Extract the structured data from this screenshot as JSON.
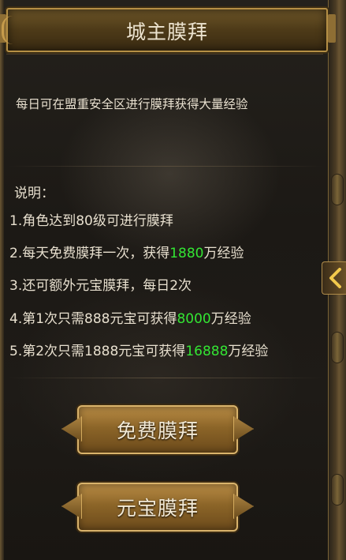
{
  "panel": {
    "title": "城主膜拜",
    "intro": "每日可在盟重安全区进行膜拜获得大量经验",
    "rules_heading": "说明：",
    "rules": [
      {
        "pre": "1.角色达到80级可进行膜拜",
        "hl": "",
        "post": ""
      },
      {
        "pre": "2.每天免费膜拜一次，获得",
        "hl": "1880",
        "post": "万经验"
      },
      {
        "pre": "3.还可额外元宝膜拜，每日2次",
        "hl": "",
        "post": ""
      },
      {
        "pre": "4.第1次只需888元宝可获得",
        "hl": "8000",
        "post": "万经验"
      },
      {
        "pre": "5.第2次只需1888元宝可获得",
        "hl": "16888",
        "post": "万经验"
      }
    ],
    "buttons": {
      "free_label": "免费膜拜",
      "ingot_label": "元宝膜拜"
    },
    "colors": {
      "highlight": "#33e633",
      "text": "#e8e0cf",
      "gold_border": "#d9b36b"
    },
    "icons": {
      "collapse": "chevron-left-icon"
    }
  }
}
